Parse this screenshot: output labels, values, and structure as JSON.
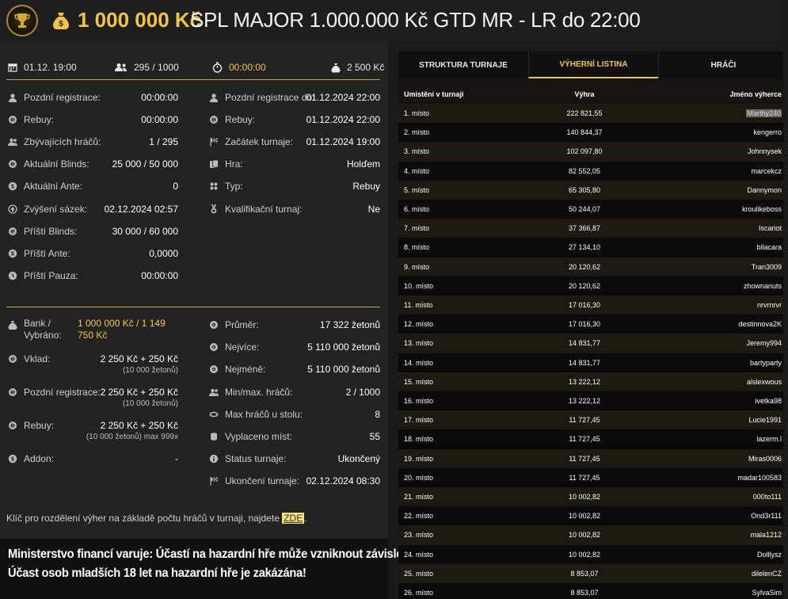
{
  "header": {
    "prize": "1 000 000 Kč",
    "title": "SPL MAJOR 1.000.000 Kč GTD MR - LR do 22:00"
  },
  "topstats": {
    "date": "01.12. 19:00",
    "players": "295 / 1000",
    "timer": "00:00:00",
    "buyin": "2 500 Kč"
  },
  "left_col": [
    {
      "label": "Pozdní registrace:",
      "value": "00:00:00",
      "icon": "user-icon"
    },
    {
      "label": "Rebuy:",
      "value": "00:00:00",
      "icon": "chip-icon"
    },
    {
      "label": "Zbývajících hráčů:",
      "value": "1 / 295",
      "icon": "users-icon"
    },
    {
      "label": "Aktuální Blinds:",
      "value": "25 000 / 50 000",
      "icon": "chip-icon"
    },
    {
      "label": "Aktuální Ante:",
      "value": "0",
      "icon": "dollar-icon"
    },
    {
      "label": "Zvýšení sázek:",
      "value": "02.12.2024 02:57",
      "icon": "arrow-icon"
    },
    {
      "label": "Příští Blinds:",
      "value": "30 000 / 60 000",
      "icon": "chip-icon"
    },
    {
      "label": "Příští Ante:",
      "value": "0,0000",
      "icon": "dollar-icon"
    },
    {
      "label": "Příští Pauza:",
      "value": "00:00:00",
      "icon": "clock-icon"
    }
  ],
  "right_col": [
    {
      "label": "Pozdní registrace do:",
      "value": "01.12.2024 22:00",
      "icon": "user-icon"
    },
    {
      "label": "Rebuy:",
      "value": "01.12.2024 22:00",
      "icon": "chip-icon"
    },
    {
      "label": "Začátek turnaje:",
      "value": "01.12.2024 19:00",
      "icon": "flag-icon"
    },
    {
      "label": "Hra:",
      "value": "Holďem",
      "icon": "cards-icon"
    },
    {
      "label": "Typ:",
      "value": "Rebuy",
      "icon": "suits-icon"
    },
    {
      "label": "Kvalifikační turnaj:",
      "value": "Ne",
      "icon": "medal-icon"
    }
  ],
  "bottom_left": [
    {
      "label": "Bank / Vybráno:",
      "value": "1 000 000 Kč / 1 149 750 Kč",
      "icon": "bank-icon"
    },
    {
      "label": "Vklad:",
      "value": "2 250 Kč + 250 Kč",
      "sub": "(10 000 žetonů)",
      "icon": "chip-icon"
    },
    {
      "label": "Pozdní registrace:",
      "value": "2 250 Kč + 250 Kč",
      "sub": "(10 000 žetonů)",
      "icon": "chip-icon"
    },
    {
      "label": "Rebuy:",
      "value": "2 250 Kč + 250 Kč",
      "sub": "(10 000 žetonů) max 999x",
      "icon": "chip-icon"
    },
    {
      "label": "Addon:",
      "value": "-",
      "icon": "dollar-icon"
    }
  ],
  "bottom_right": [
    {
      "label": "Průměr:",
      "value": "17 322 žetonů",
      "icon": "gear-icon"
    },
    {
      "label": "Nejvíce:",
      "value": "5 110 000 žetonů",
      "icon": "gear-icon"
    },
    {
      "label": "Nejméně:",
      "value": "5 110 000 žetonů",
      "icon": "gear-icon"
    },
    {
      "label": "Min/max. hráčů:",
      "value": "2 / 1000",
      "icon": "users-icon"
    },
    {
      "label": "Max hráčů u stolu:",
      "value": "8",
      "icon": "table-icon"
    },
    {
      "label": "Vyplaceno míst:",
      "value": "55",
      "icon": "coins-icon"
    },
    {
      "label": "Status turnaje:",
      "value": "Ukončený",
      "icon": "info-icon"
    },
    {
      "label": "Ukončení turnaje:",
      "value": "02.12.2024 08:30",
      "icon": "flag-icon"
    }
  ],
  "note": {
    "text": "Klíč pro rozdělení výher na základě počtu hráčů v turnaji, najdete ",
    "link": "ZDE",
    "end": "."
  },
  "warning": {
    "line1": "Ministerstvo financí varuje: Účastí na hazardní hře může vzniknout závislost!",
    "line2": "Účast osob mladších 18 let na hazardní hře je zakázána!"
  },
  "tabs": [
    "STRUKTURA TURNAJE",
    "VÝHERNÍ LISTINA",
    "HRÁČI"
  ],
  "active_tab": 1,
  "table": {
    "headers": [
      "Umístění v turnaji",
      "Výhra",
      "Jméno výherce"
    ],
    "rows": [
      [
        "1. místo",
        "222 821,55",
        "Marthy240"
      ],
      [
        "2. místo",
        "140 844,37",
        "kengerro"
      ],
      [
        "3. místo",
        "102 097,80",
        "Johnnysek"
      ],
      [
        "4. místo",
        "82 552,05",
        "marcekcz"
      ],
      [
        "5. místo",
        "65 305,80",
        "Dannymon"
      ],
      [
        "6. místo",
        "50 244,07",
        "kroulikeboss"
      ],
      [
        "7. místo",
        "37 366,87",
        "Iscariot"
      ],
      [
        "8. místo",
        "27 134,10",
        "bilacara"
      ],
      [
        "9. místo",
        "20 120,62",
        "Tran3009"
      ],
      [
        "10. místo",
        "20 120,62",
        "zhownanuts"
      ],
      [
        "11. místo",
        "17 016,30",
        "nrvrnrvr"
      ],
      [
        "12. místo",
        "17 016,30",
        "destinnova2K"
      ],
      [
        "13. místo",
        "14 831,77",
        "Jeremy994"
      ],
      [
        "14. místo",
        "14 831,77",
        "bartyparty"
      ],
      [
        "15. místo",
        "13 222,12",
        "alslexwous"
      ],
      [
        "16. místo",
        "13 222,12",
        "ivetka98"
      ],
      [
        "17. místo",
        "11 727,45",
        "Lucie1991"
      ],
      [
        "18. místo",
        "11 727,45",
        "lazerm.l"
      ],
      [
        "19. místo",
        "11 727,45",
        "Miras0006"
      ],
      [
        "20. místo",
        "11 727,45",
        "madar100583"
      ],
      [
        "21. místo",
        "10 002,82",
        "000to111"
      ],
      [
        "22. místo",
        "10 002,82",
        "Ond3r111"
      ],
      [
        "23. místo",
        "10 002,82",
        "mala1212"
      ],
      [
        "24. místo",
        "10 002,82",
        "Dolllysz"
      ],
      [
        "25. místo",
        "8 853,07",
        "dilelenCZ"
      ],
      [
        "26. místo",
        "8 853,07",
        "SylvaSim"
      ]
    ]
  }
}
